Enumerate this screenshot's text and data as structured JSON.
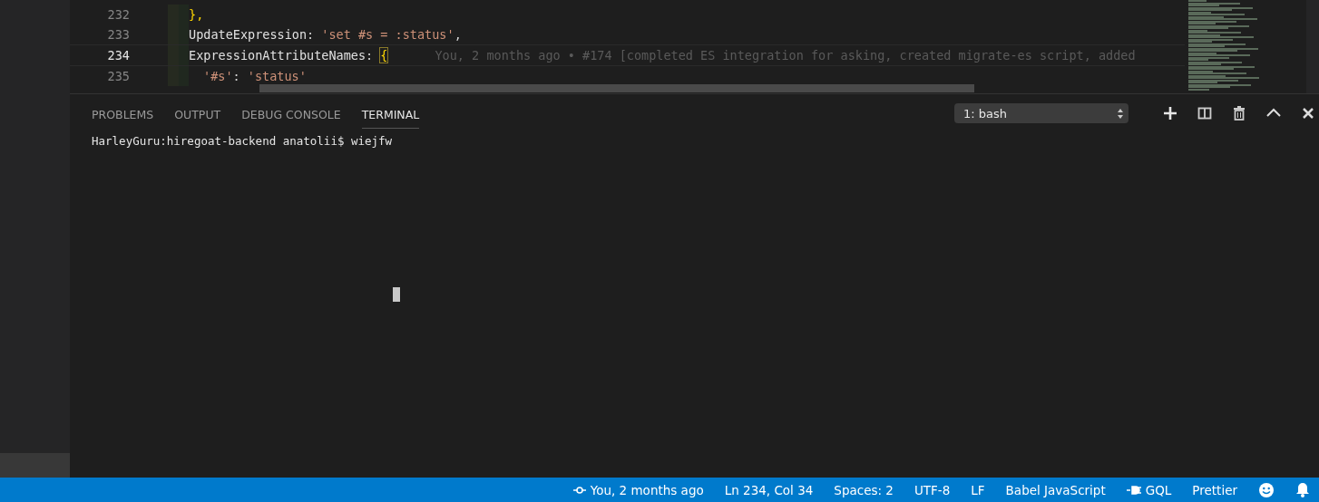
{
  "editor": {
    "lines": [
      {
        "number": "232",
        "active": false,
        "indent": false,
        "tokens": [
          {
            "kind": "punct",
            "text": "},"
          }
        ]
      },
      {
        "number": "233",
        "active": false,
        "indent": false,
        "tokens": [
          {
            "kind": "key",
            "text": "UpdateExpression"
          },
          {
            "kind": "plain",
            "text": ": "
          },
          {
            "kind": "string",
            "text": "'set #s = :status'"
          },
          {
            "kind": "plain",
            "text": ","
          }
        ]
      },
      {
        "number": "234",
        "active": true,
        "indent": false,
        "tokens": [
          {
            "kind": "key",
            "text": "ExpressionAttributeNames"
          },
          {
            "kind": "plain",
            "text": ": "
          },
          {
            "kind": "bracket",
            "text": "{"
          }
        ],
        "blame": "You, 2 months ago • #174 [completed ES integration for asking, created migrate-es script, added"
      },
      {
        "number": "235",
        "active": false,
        "indent": true,
        "tokens": [
          {
            "kind": "string",
            "text": "'#s'"
          },
          {
            "kind": "plain",
            "text": ": "
          },
          {
            "kind": "string",
            "text": "'status'"
          }
        ]
      }
    ]
  },
  "panel": {
    "tabs": [
      {
        "label": "PROBLEMS",
        "selected": false
      },
      {
        "label": "OUTPUT",
        "selected": false
      },
      {
        "label": "DEBUG CONSOLE",
        "selected": false
      },
      {
        "label": "TERMINAL",
        "selected": true
      }
    ],
    "terminal_select": "1: bash",
    "terminal_line": "HarleyGuru:hiregoat-backend anatolii$ wiejfw"
  },
  "status_bar": {
    "items": [
      {
        "kind": "blame",
        "text": "You, 2 months ago"
      },
      {
        "kind": "text",
        "text": "Ln 234, Col 34"
      },
      {
        "kind": "text",
        "text": "Spaces: 2"
      },
      {
        "kind": "text",
        "text": "UTF-8"
      },
      {
        "kind": "text",
        "text": "LF"
      },
      {
        "kind": "text",
        "text": "Babel JavaScript"
      },
      {
        "kind": "plug",
        "text": "GQL"
      },
      {
        "kind": "text",
        "text": "Prettier"
      },
      {
        "kind": "smiley"
      },
      {
        "kind": "bell"
      }
    ]
  }
}
